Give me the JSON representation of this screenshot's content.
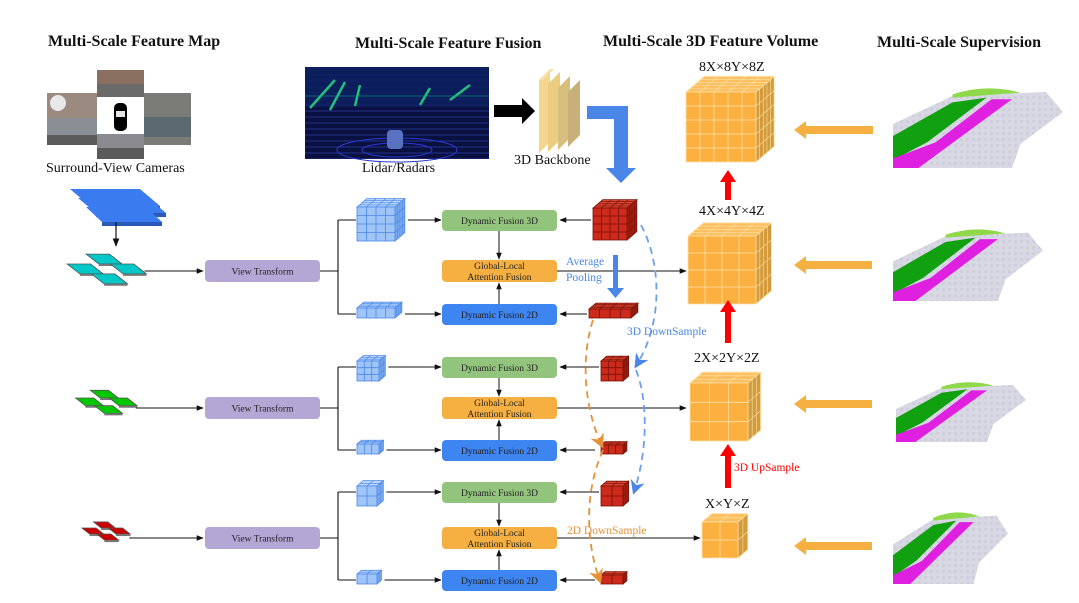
{
  "sections": {
    "feature_map": "Multi-Scale Feature Map",
    "feature_fusion": "Multi-Scale Feature Fusion",
    "feature_volume": "Multi-Scale 3D Feature Volume",
    "supervision": "Multi-Scale Supervision"
  },
  "inputs": {
    "cameras_caption": "Surround-View Cameras",
    "lidar_caption": "Lidar/Radars",
    "backbone_caption": "3D Backbone"
  },
  "rows": [
    {
      "scale_color": "#00c8c8",
      "view_transform": "View Transform",
      "fusion_3d": "Dynamic Fusion 3D",
      "attention_line1": "Global-Local",
      "attention_line2": "Attention Fusion",
      "fusion_2d": "Dynamic Fusion 2D",
      "volume_label": "4X×4Y×4Z"
    },
    {
      "scale_color": "#00c800",
      "view_transform": "View Transform",
      "fusion_3d": "Dynamic Fusion 3D",
      "attention_line1": "Global-Local",
      "attention_line2": "Attention Fusion",
      "fusion_2d": "Dynamic Fusion 2D",
      "volume_label": "2X×2Y×2Z"
    },
    {
      "scale_color": "#cc0000",
      "view_transform": "View Transform",
      "fusion_3d": "Dynamic Fusion 3D",
      "attention_line1": "Global-Local",
      "attention_line2": "Attention Fusion",
      "fusion_2d": "Dynamic Fusion 2D",
      "volume_label": "X×Y×Z"
    }
  ],
  "top_volume_label": "8X×8Y×8Z",
  "annotations": {
    "average_pooling_line1": "Average",
    "average_pooling_line2": "Pooling",
    "downsample_3d": "3D DownSample",
    "downsample_2d": "2D DownSample",
    "upsample_3d": "3D UpSample"
  },
  "colors": {
    "fusion_3d_box": "#93c47d",
    "attention_box": "#f6b042",
    "fusion_2d_box": "#3d85f0",
    "view_transform_box": "#b4a7d6",
    "volume_orange": "#fbb040",
    "lidar_red": "#cc2a1a",
    "camera_blue": "#8ab4f0",
    "arrow_red": "#ff0000",
    "arrow_orange": "#f6b042",
    "arrow_blue": "#4a86e8"
  }
}
